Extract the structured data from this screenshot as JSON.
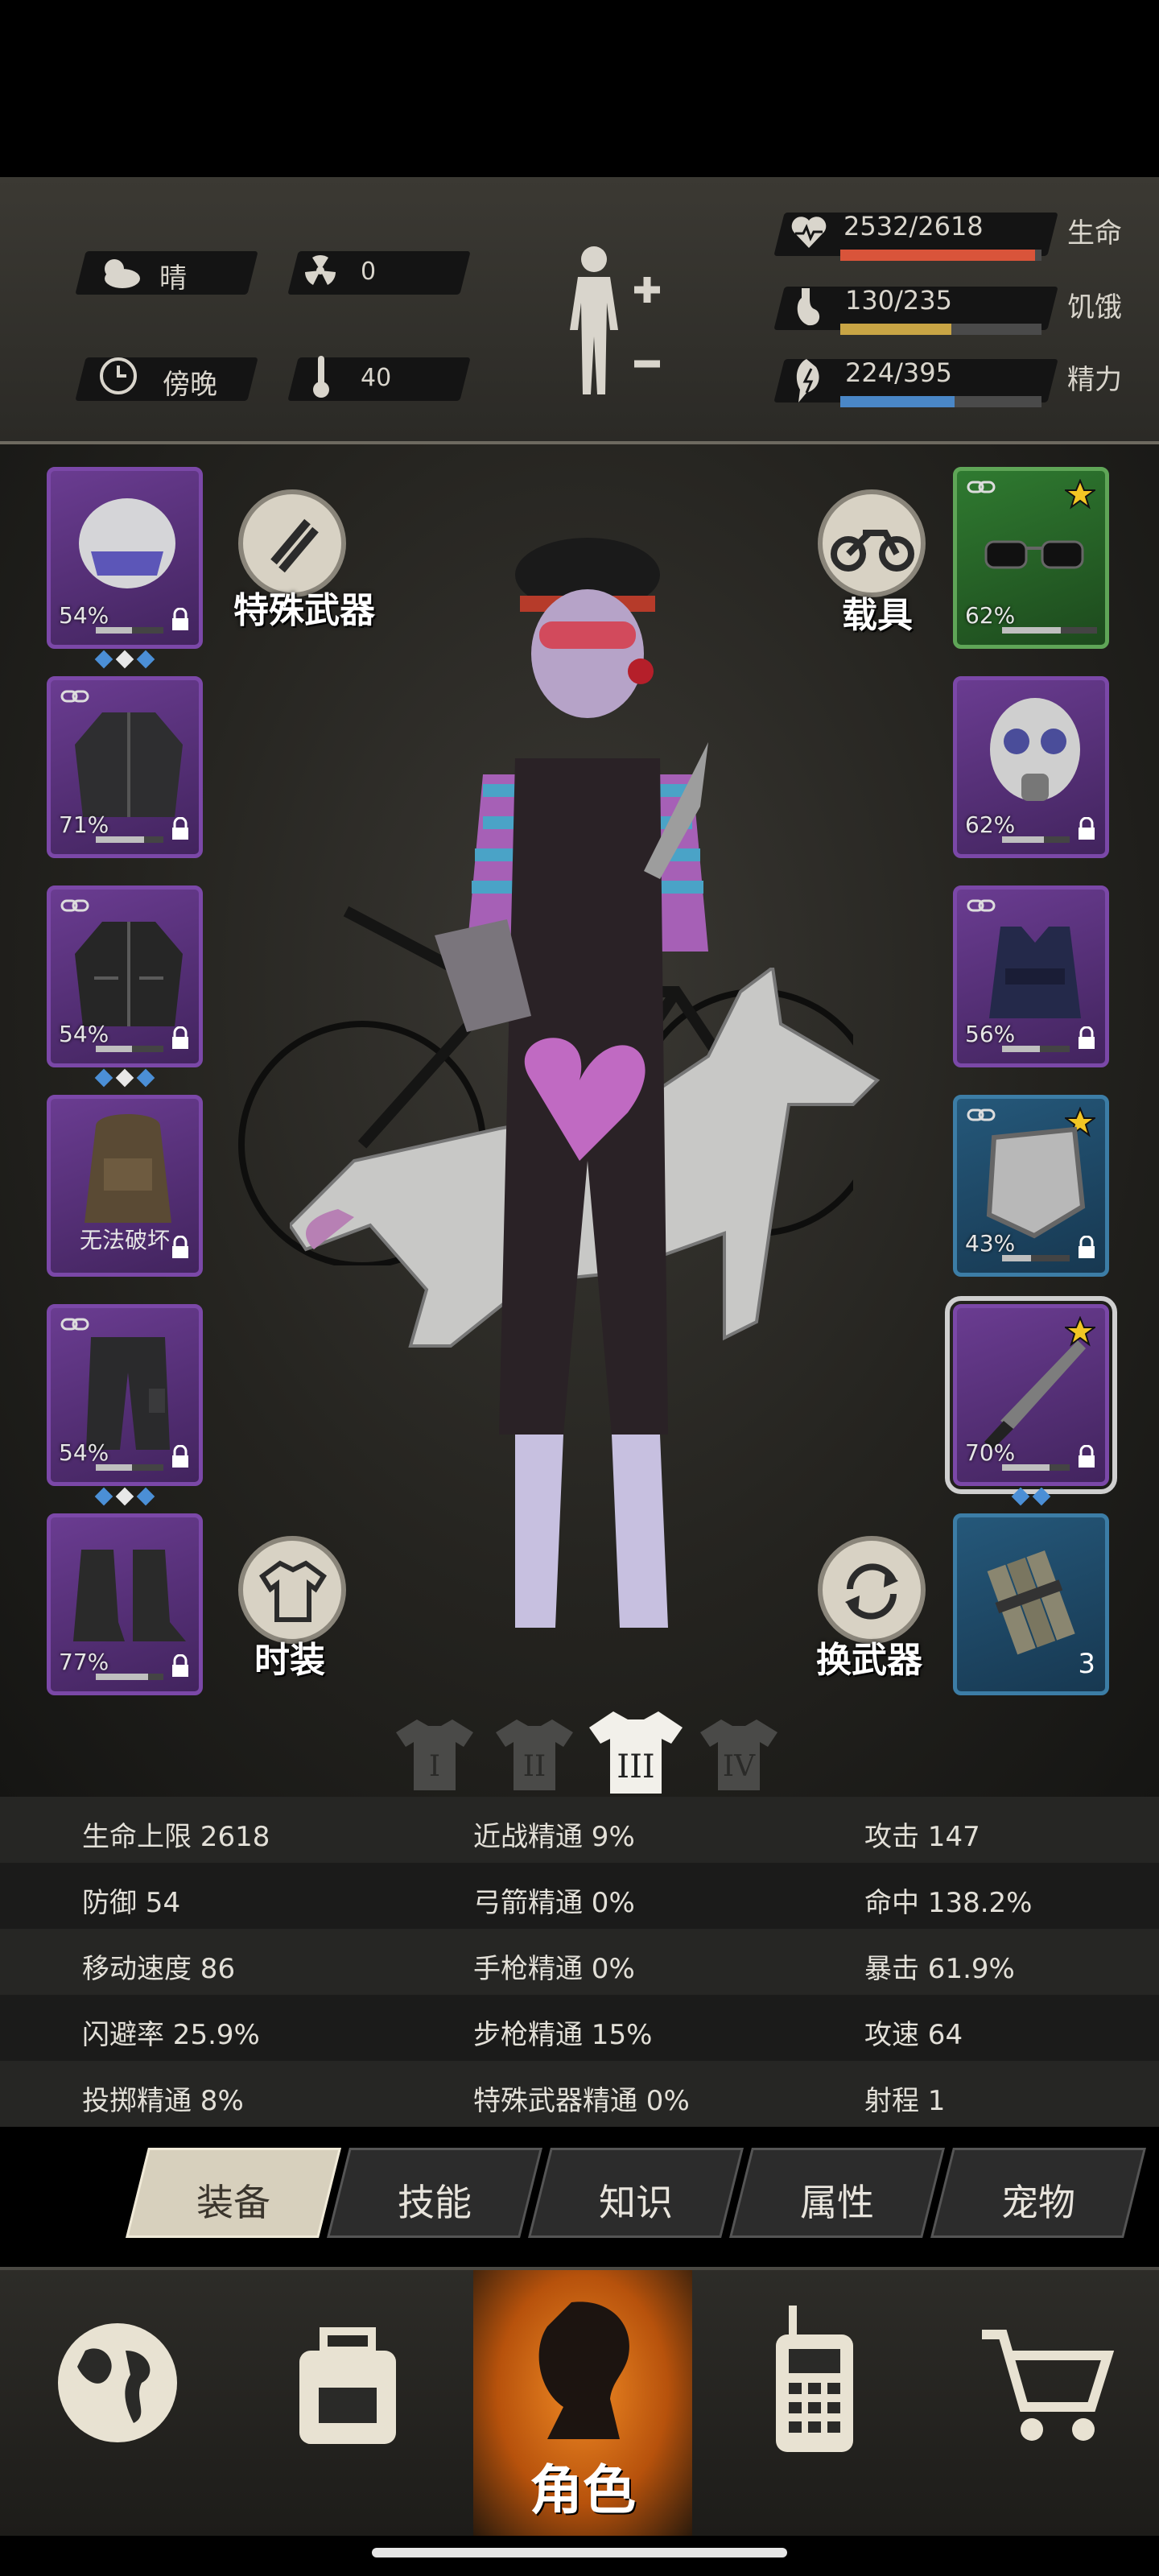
{
  "status": {
    "weather": "晴",
    "radiation": "0",
    "time_of_day": "傍晚",
    "temperature": "40",
    "health": {
      "value": "2532/2618",
      "label": "生命",
      "fraction": 0.967,
      "color": "#d9543a"
    },
    "hunger": {
      "value": "130/235",
      "label": "饥饿",
      "fraction": 0.553,
      "color": "#c9a545"
    },
    "energy": {
      "value": "224/395",
      "label": "精力",
      "fraction": 0.567,
      "color": "#4a87c7"
    }
  },
  "buttons": {
    "special_weapon": "特殊武器",
    "vehicle": "载具",
    "fashion": "时装",
    "switch_weapon": "换武器"
  },
  "left_slots": [
    {
      "pct": "54%",
      "durability": 0.54,
      "gems": [
        "blue",
        "white",
        "blue"
      ],
      "icon": "police-helmet-icon"
    },
    {
      "pct": "71%",
      "durability": 0.71,
      "gems": [],
      "icon": "jacket-icon",
      "linked": true
    },
    {
      "pct": "54%",
      "durability": 0.54,
      "gems": [
        "blue",
        "white",
        "blue"
      ],
      "icon": "leather-jacket-icon",
      "linked": true
    },
    {
      "pct": "",
      "note": "无法破坏",
      "durability": 0,
      "gems": [],
      "icon": "backpack-icon"
    },
    {
      "pct": "54%",
      "durability": 0.54,
      "gems": [
        "blue",
        "white",
        "blue"
      ],
      "icon": "cargo-pants-icon",
      "linked": true
    },
    {
      "pct": "77%",
      "durability": 0.77,
      "gems": [],
      "icon": "boots-icon"
    }
  ],
  "right_slots": [
    {
      "pct": "62%",
      "durability": 0.62,
      "rarity": "green",
      "icon": "sunglasses-icon",
      "linked": true,
      "star": true
    },
    {
      "pct": "62%",
      "durability": 0.62,
      "rarity": "purple",
      "icon": "gas-mask-icon"
    },
    {
      "pct": "56%",
      "durability": 0.56,
      "rarity": "purple",
      "icon": "police-vest-icon",
      "linked": true
    },
    {
      "pct": "43%",
      "durability": 0.43,
      "rarity": "blue",
      "icon": "riot-shield-icon",
      "linked": true,
      "star": true
    },
    {
      "pct": "70%",
      "durability": 0.7,
      "rarity": "purple",
      "icon": "machete-icon",
      "star": true,
      "selected": true,
      "gems": [
        "blue",
        "blue"
      ]
    },
    {
      "count": "3",
      "rarity": "blue",
      "icon": "dynamite-icon"
    }
  ],
  "outfit_tabs": [
    "I",
    "II",
    "III",
    "IV"
  ],
  "outfit_active": 2,
  "stats": [
    [
      "生命上限 2618",
      "近战精通 9%",
      "攻击 147"
    ],
    [
      "防御 54",
      "弓箭精通 0%",
      "命中 138.2%"
    ],
    [
      "移动速度 86",
      "手枪精通 0%",
      "暴击 61.9%"
    ],
    [
      "闪避率 25.9%",
      "步枪精通 15%",
      "攻速 64"
    ],
    [
      "投掷精通 8%",
      "特殊武器精通 0%",
      "射程 1"
    ]
  ],
  "tabs": [
    "装备",
    "技能",
    "知识",
    "属性",
    "宠物"
  ],
  "active_tab": 0,
  "nav": {
    "items": [
      "globe-icon",
      "backpack-icon",
      "character-icon",
      "radio-icon",
      "cart-icon"
    ],
    "active_label": "角色"
  }
}
